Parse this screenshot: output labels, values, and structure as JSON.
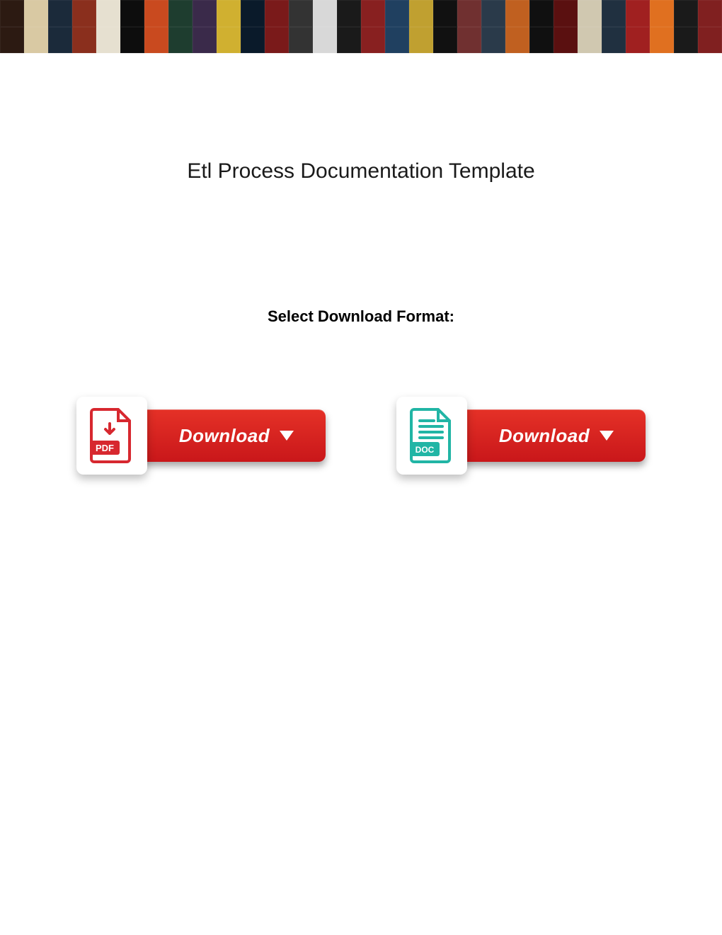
{
  "title": "Etl Process Documentation Template",
  "subheading": "Select Download Format:",
  "buttons": {
    "pdf": {
      "format_label": "PDF",
      "button_label": "Download"
    },
    "doc": {
      "format_label": "DOC",
      "button_label": "Download"
    }
  },
  "colors": {
    "pdf": "#d7282f",
    "doc": "#21b5a5",
    "button_red_top": "#e53127",
    "button_red_bottom": "#c9171a"
  }
}
